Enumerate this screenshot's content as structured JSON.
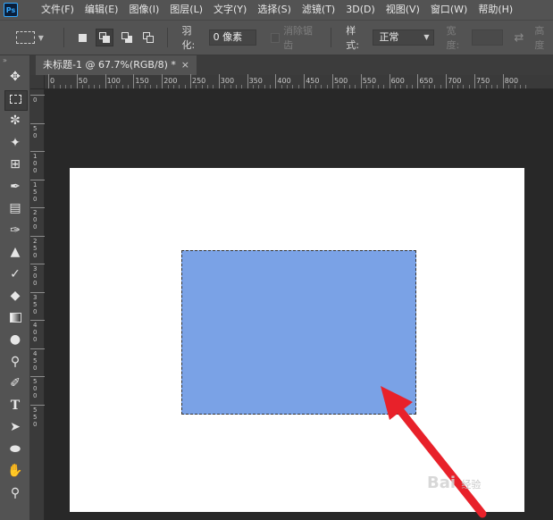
{
  "app": {
    "logo_text": "Ps"
  },
  "menu": [
    "文件(F)",
    "编辑(E)",
    "图像(I)",
    "图层(L)",
    "文字(Y)",
    "选择(S)",
    "滤镜(T)",
    "3D(D)",
    "视图(V)",
    "窗口(W)",
    "帮助(H)"
  ],
  "options": {
    "feather_label": "羽化:",
    "feather_value": "0 像素",
    "antialias_label": "消除锯齿",
    "style_label": "样式:",
    "style_value": "正常",
    "width_label": "宽度:",
    "height_label": "高度"
  },
  "document_tab": {
    "title": "未标题-1 @ 67.7%(RGB/8) *",
    "close": "×"
  },
  "ruler_h": [
    "0",
    "50",
    "100",
    "150",
    "200",
    "250",
    "300",
    "350",
    "400",
    "450",
    "500",
    "550",
    "600",
    "650",
    "700",
    "750",
    "800"
  ],
  "ruler_v": [
    "0",
    "5 0",
    "1 0 0",
    "1 5 0",
    "2 0 0",
    "2 5 0",
    "3 0 0",
    "3 5 0",
    "4 0 0",
    "4 5 0",
    "5 0 0",
    "5 5 0"
  ],
  "tools": [
    "move-tool-icon",
    "marquee-tool-icon",
    "lasso-tool-icon",
    "magic-wand-tool-icon",
    "crop-tool-icon",
    "eyedropper-tool-icon",
    "healing-brush-tool-icon",
    "brush-tool-icon",
    "clone-stamp-tool-icon",
    "history-brush-tool-icon",
    "eraser-tool-icon",
    "gradient-tool-icon",
    "blur-tool-icon",
    "dodge-tool-icon",
    "pen-tool-icon",
    "type-tool-icon",
    "path-selection-tool-icon",
    "ellipse-tool-icon",
    "hand-tool-icon",
    "zoom-tool-icon"
  ],
  "selection_color": "#7aa2e6",
  "arrow_color": "#e8212a",
  "watermark": {
    "brand": "Bai",
    "sub": "经验"
  }
}
